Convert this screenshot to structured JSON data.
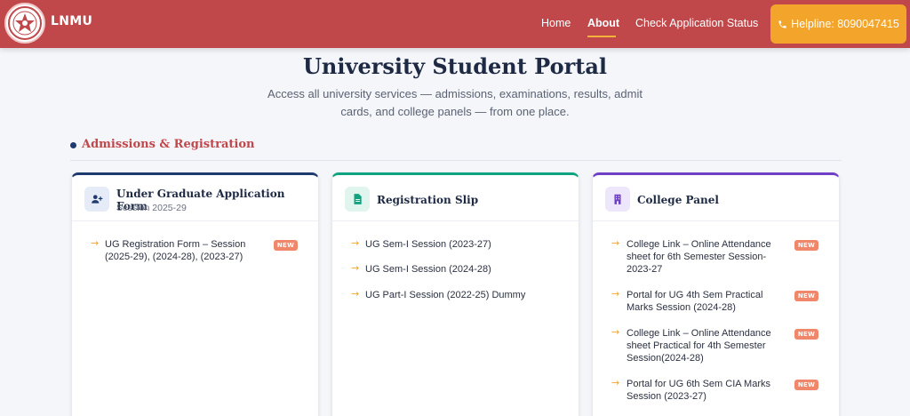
{
  "navbar": {
    "brand": "LNMU",
    "links": [
      "Home",
      "About",
      "Check Application Status"
    ],
    "active": "About",
    "helpline": "Helpline: 8090047415",
    "colors": {
      "bar": "#c0474a",
      "helpline": "#f3a42b"
    }
  },
  "header": {
    "title": "University Student Portal",
    "subtitle": "Access all university services — admissions, examinations, results, admit cards, and college panels — from one place."
  },
  "section": {
    "title": "Admissions & Registration"
  },
  "cards": [
    {
      "title": "Under Graduate Application Form",
      "session": "Session 2025-29",
      "icon": "user-plus-icon",
      "items": [
        {
          "label": "UG Registration Form – Session (2025-29), (2024-28), (2023-27)",
          "badge": "NEW"
        }
      ]
    },
    {
      "title": "Registration Slip",
      "icon": "document-icon",
      "items": [
        {
          "label": "UG Sem-I Session (2023-27)"
        },
        {
          "label": "UG Sem-I Session (2024-28)"
        },
        {
          "label": "UG Part-I Session (2022-25) Dummy"
        }
      ]
    },
    {
      "title": "College Panel",
      "icon": "building-icon",
      "items": [
        {
          "label": "College Link – Online Attendance sheet for 6th Semester Session-2023-27",
          "badge": "NEW"
        },
        {
          "label": "Portal for UG 4th Sem Practical Marks Session (2024-28)",
          "badge": "NEW"
        },
        {
          "label": "College Link – Online Attendance sheet Practical for 4th Semester Session(2024-28)",
          "badge": "NEW"
        },
        {
          "label": "Portal for UG 6th Sem CIA Marks Session (2023-27)",
          "badge": "NEW"
        }
      ]
    }
  ]
}
